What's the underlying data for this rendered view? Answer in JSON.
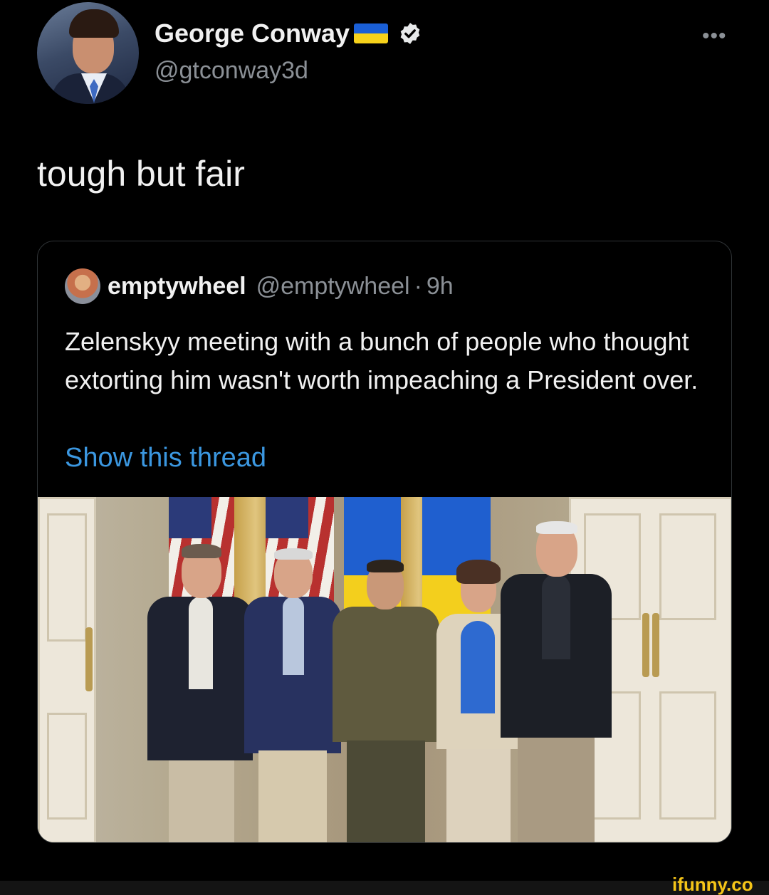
{
  "tweet": {
    "author": {
      "display_name": "George Conway",
      "flag_icon": "ukraine-flag-icon",
      "verified_icon": "verified-badge-icon",
      "handle": "@gtconway3d"
    },
    "more_icon": "more-options-icon",
    "more_label": "•••",
    "text": "tough but fair"
  },
  "quote": {
    "author_name": "emptywheel",
    "handle": "@emptywheel",
    "separator": "·",
    "time": "9h",
    "text": "Zelenskyy meeting with a bunch of people who thought extorting him wasn't worth impeaching a President over.",
    "show_thread": "Show this thread"
  },
  "watermark": "ifunny.co",
  "colors": {
    "background": "#000000",
    "link": "#3b97e0",
    "secondary_text": "#8b9096",
    "watermark": "#f5c518"
  }
}
